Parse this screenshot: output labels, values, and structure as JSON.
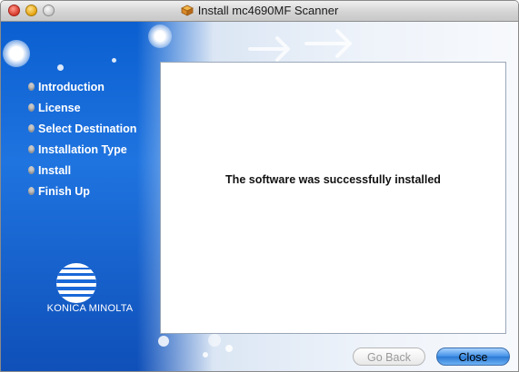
{
  "window": {
    "title": "Install mc4690MF Scanner",
    "icon": "package-installer-icon"
  },
  "steps": [
    {
      "label": "Introduction"
    },
    {
      "label": "License"
    },
    {
      "label": "Select Destination"
    },
    {
      "label": "Installation Type"
    },
    {
      "label": "Install"
    },
    {
      "label": "Finish Up"
    }
  ],
  "content": {
    "message": "The software was successfully installed"
  },
  "brand": {
    "name": "KONICA MINOLTA",
    "accent": "#0b5fd0"
  },
  "buttons": {
    "back": {
      "label": "Go Back",
      "enabled": false
    },
    "close": {
      "label": "Close",
      "enabled": true,
      "default": true
    }
  }
}
